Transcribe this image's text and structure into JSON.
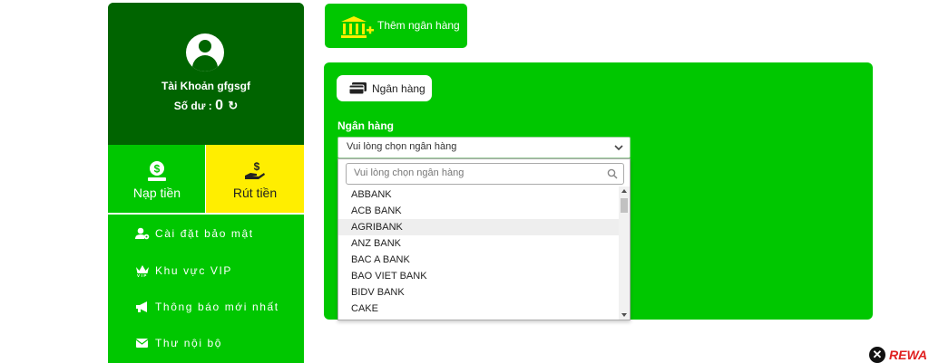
{
  "sidebar": {
    "account_label": "Tài Khoản gfgsgf",
    "balance_label": "Số dư :",
    "balance_value": "0",
    "deposit_label": "Nạp tiền",
    "withdraw_label": "Rút tiền",
    "menu": [
      {
        "label": "Cài đặt bảo mật",
        "icon": "user-gear-icon"
      },
      {
        "label": "Khu vực VIP",
        "icon": "crown-icon"
      },
      {
        "label": "Thông báo mới nhất",
        "icon": "megaphone-icon"
      },
      {
        "label": "Thư nội bộ",
        "icon": "envelope-icon"
      }
    ]
  },
  "toolbar": {
    "add_bank_label": "Thêm ngân hàng"
  },
  "panel": {
    "tab_label": "Ngân hàng",
    "field_label": "Ngân hàng",
    "select_value": "Vui lòng chọn ngân hàng",
    "search_placeholder": "Vui lòng chọn ngân hàng",
    "options": [
      "ABBANK",
      "ACB BANK",
      "AGRIBANK",
      "ANZ BANK",
      "BAC A BANK",
      "BAO VIET BANK",
      "BIDV BANK",
      "CAKE"
    ],
    "highlighted_option": "AGRIBANK"
  },
  "overlay": {
    "rewards_label": "REWA"
  },
  "colors": {
    "primary_green": "#00c700",
    "dark_green": "#006400",
    "yellow": "#ffee00"
  }
}
